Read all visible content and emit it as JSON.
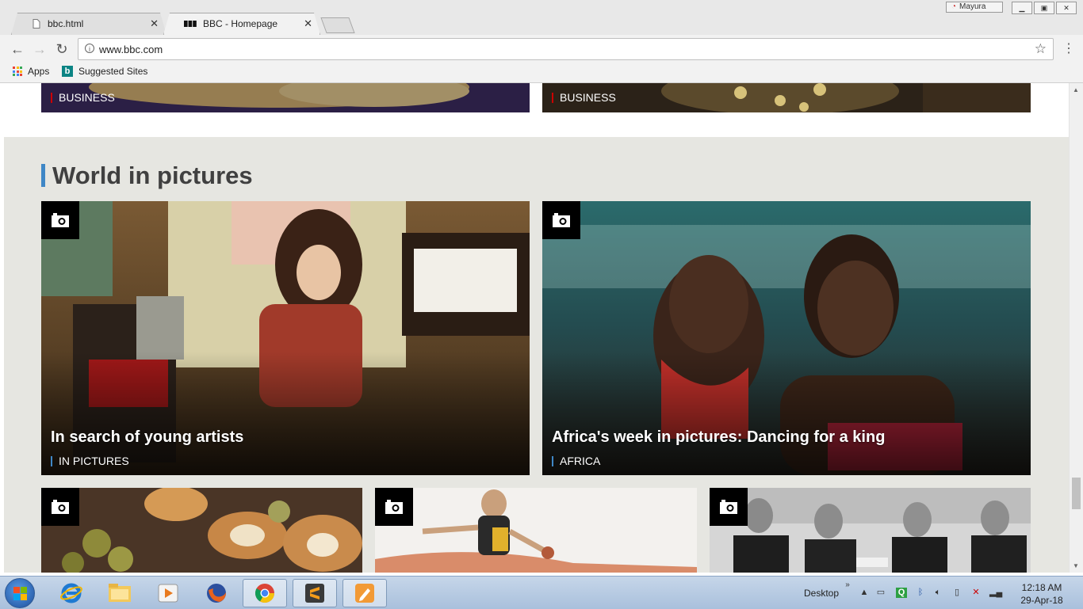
{
  "browser": {
    "profile_name": "Mayura",
    "tabs": [
      {
        "title": "bbc.html",
        "active": false
      },
      {
        "title": "BBC - Homepage",
        "active": true
      }
    ],
    "url": "www.bbc.com",
    "bookmarks": [
      {
        "label": "Apps"
      },
      {
        "label": "Suggested Sites"
      }
    ]
  },
  "page": {
    "top_tiles": [
      {
        "category": "BUSINESS"
      },
      {
        "category": "BUSINESS"
      }
    ],
    "section_title": "World in pictures",
    "featured": [
      {
        "headline": "In search of young artists",
        "tag": "IN PICTURES"
      },
      {
        "headline": "Africa's week in pictures: Dancing for a king",
        "tag": "AFRICA"
      }
    ],
    "thumbnails": [
      {
        "subject": "breads-and-pears-photo"
      },
      {
        "subject": "desert-runner-photo"
      },
      {
        "subject": "vintage-group-photo"
      }
    ]
  },
  "taskbar": {
    "desktop_label": "Desktop",
    "time": "12:18 AM",
    "date": "29-Apr-18"
  },
  "colors": {
    "bbc_blue_accent": "#3f87c6",
    "business_red": "#cc0000",
    "section_bg": "#e6e6e1"
  }
}
